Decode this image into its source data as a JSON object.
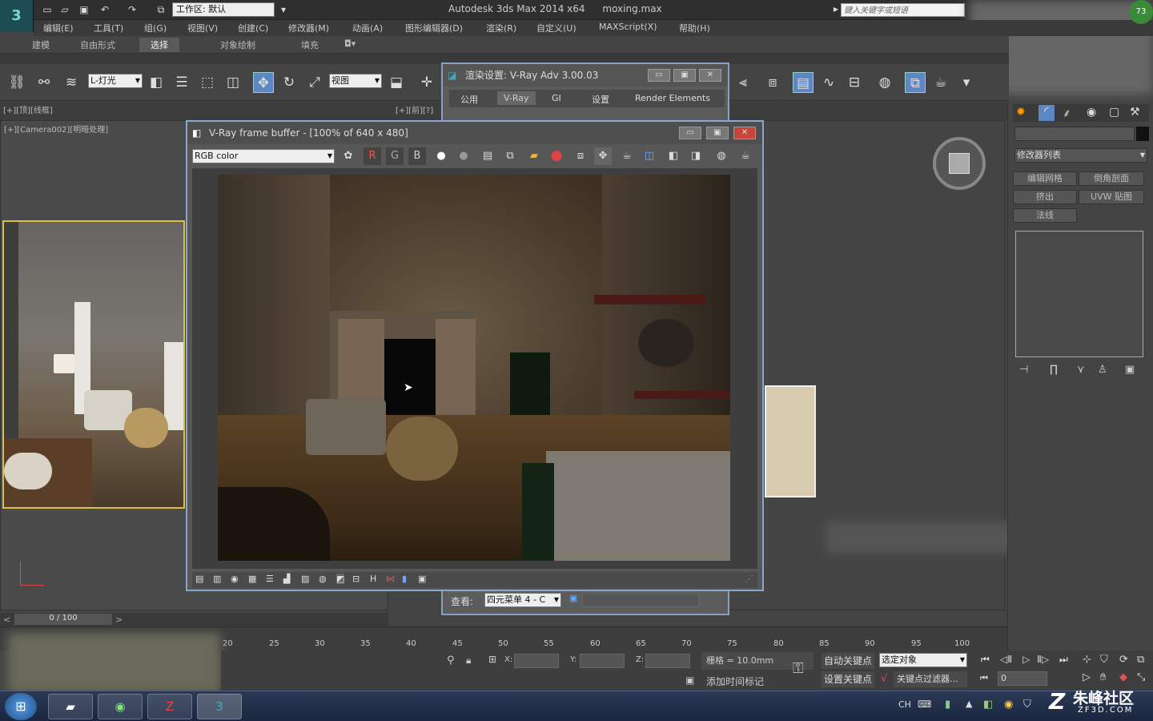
{
  "titlebar": {
    "workspace_label": "工作区: 默认",
    "app_title": "Autodesk 3ds Max  2014 x64",
    "file_name": "moxing.max",
    "search_placeholder": "键入关键字或短语"
  },
  "menus": [
    "编辑(E)",
    "工具(T)",
    "组(G)",
    "视图(V)",
    "创建(C)",
    "修改器(M)",
    "动画(A)",
    "图形编辑器(D)",
    "渲染(R)",
    "自定义(U)",
    "MAXScript(X)",
    "帮助(H)"
  ],
  "ribbon": {
    "tabs": [
      "建模",
      "自由形式",
      "选择",
      "对象绘制",
      "填充"
    ],
    "selected": "选择"
  },
  "toolbar": {
    "selection_set": "L-灯光",
    "ref_coord": "视图"
  },
  "viewports": {
    "top_left_label": "[+][顶][线框]",
    "camera_label": "[+][Camera002][明暗处理]",
    "small_label": "[+][前][?]"
  },
  "render_setup": {
    "title": "渲染设置: V-Ray Adv 3.00.03",
    "tabs": [
      "公用",
      "V-Ray",
      "GI",
      "设置",
      "Render Elements"
    ],
    "view_label": "查看:",
    "view_value": "四元菜单 4 - C"
  },
  "frame_buffer": {
    "title": "V-Ray frame buffer - [100% of 640 x 480]",
    "channel": "RGB color",
    "r": "R",
    "g": "G",
    "b": "B",
    "bottom_h": "H"
  },
  "command_panel": {
    "modifier_list": "修改器列表",
    "buttons": [
      "编辑网格",
      "倒角剖面",
      "挤出",
      "UVW 贴图",
      "法线"
    ],
    "badge": "73"
  },
  "timeline": {
    "frame": "0 / 100",
    "ticks": [
      "20",
      "25",
      "30",
      "35",
      "40",
      "45",
      "50",
      "55",
      "60",
      "65",
      "70",
      "75",
      "80",
      "85",
      "90",
      "95",
      "100"
    ]
  },
  "status": {
    "x": "X:",
    "y": "Y:",
    "z": "Z:",
    "grid": "栅格 = 10.0mm",
    "autokey": "自动关键点",
    "setkey": "设置关键点",
    "sel_object": "选定对象",
    "key_filter": "关键点过滤器...",
    "add_time_tag": "添加时间标记",
    "frame_value": "0"
  },
  "taskbar": {
    "lang": "CH",
    "watermark": "朱峰社区",
    "watermark_url": "ZF3D.COM"
  }
}
